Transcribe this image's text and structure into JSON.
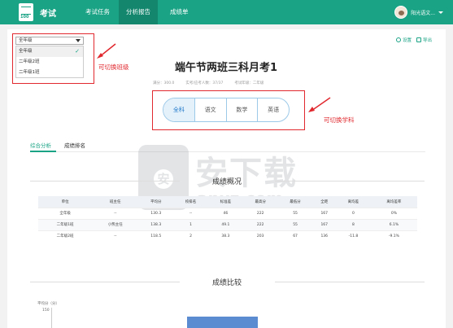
{
  "nav": {
    "brand": "考试",
    "logo_text": "100",
    "items": [
      {
        "label": "考试任务",
        "active": false
      },
      {
        "label": "分析报告",
        "active": true
      },
      {
        "label": "成绩单",
        "active": false
      }
    ],
    "user_name": "阳光语文..."
  },
  "class_selector": {
    "selected": "全年级",
    "options": [
      "全年级",
      "二年级2班",
      "二年级1班"
    ]
  },
  "annotations": {
    "class_switch": "可切换班级",
    "subject_switch": "可切换学科"
  },
  "tools": {
    "settings": "设置",
    "export": "导出"
  },
  "exam": {
    "title": "端午节两班三科月考1",
    "full_score": "满分：300.0",
    "participants": "实考/应考人数：37/37",
    "grade": "考试年级：二年级"
  },
  "subjects": [
    {
      "label": "全科",
      "active": true
    },
    {
      "label": "语文",
      "active": false
    },
    {
      "label": "数学",
      "active": false
    },
    {
      "label": "英语",
      "active": false
    }
  ],
  "tabs": [
    {
      "label": "综合分析",
      "active": true
    },
    {
      "label": "成绩排名",
      "active": false
    }
  ],
  "summary": {
    "title": "成绩概况",
    "columns": [
      "单位",
      "班主任",
      "平均分",
      "校排名",
      "标准差",
      "最高分",
      "最低分",
      "全距",
      "离均差",
      "离均差率"
    ],
    "rows": [
      [
        "全年级",
        "--",
        "130.3",
        "--",
        "46",
        "222",
        "55",
        "167",
        "0",
        "0%"
      ],
      [
        "二年级1班",
        "小熊主任",
        "138.3",
        "1",
        "49.1",
        "222",
        "55",
        "167",
        "8",
        "6.1%"
      ],
      [
        "二年级2班",
        "--",
        "118.5",
        "2",
        "38.3",
        "203",
        "67",
        "136",
        "-11.8",
        "-9.1%"
      ]
    ]
  },
  "comparison": {
    "title": "成绩比较",
    "y_label": "平均分（分）",
    "y_top_tick": "150"
  },
  "watermark": {
    "text": "安下载",
    "sub": "anxz.com",
    "badge": "安"
  }
}
